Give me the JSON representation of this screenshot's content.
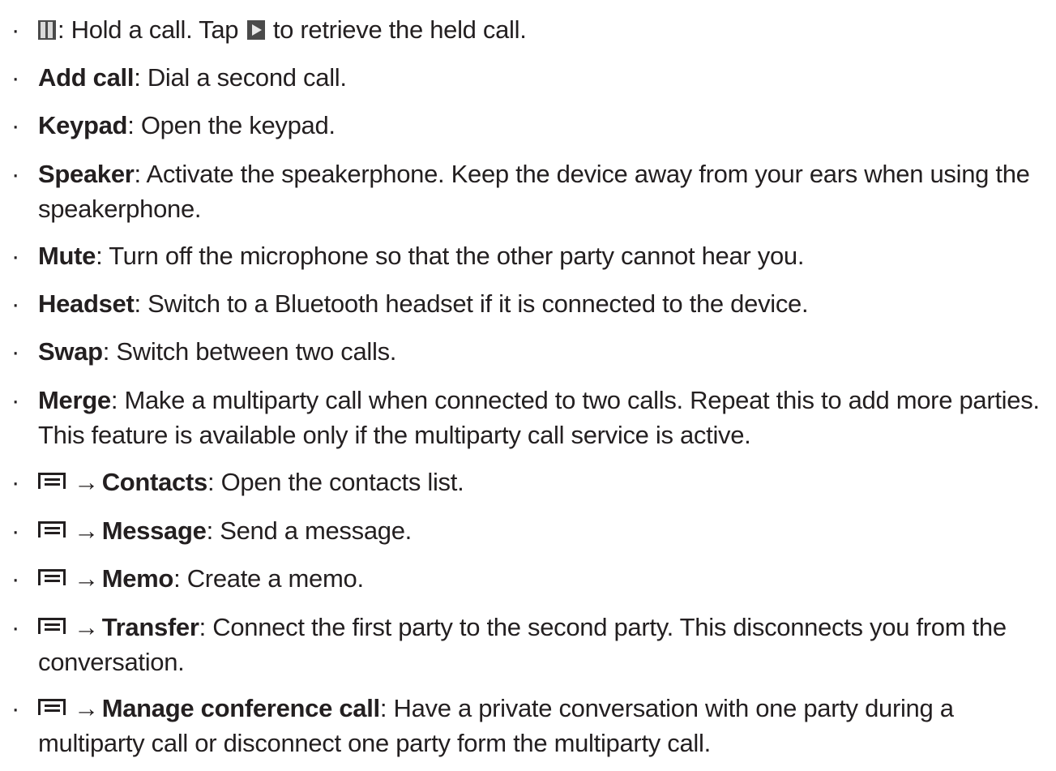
{
  "items": [
    {
      "icon": "pause-icon",
      "label": "",
      "text": ": Hold a call. Tap ",
      "icon2": "play-icon",
      "text2": " to retrieve the held call."
    },
    {
      "label": "Add call",
      "text": ": Dial a second call."
    },
    {
      "label": "Keypad",
      "text": ": Open the keypad."
    },
    {
      "label": "Speaker",
      "text": ": Activate the speakerphone. Keep the device away from your ears when using the speakerphone."
    },
    {
      "label": "Mute",
      "text": ": Turn off the microphone so that the other party cannot hear you."
    },
    {
      "label": "Headset",
      "text": ": Switch to a Bluetooth headset if it is connected to the device."
    },
    {
      "label": "Swap",
      "text": ": Switch between two calls."
    },
    {
      "label": "Merge",
      "text": ": Make a multiparty call when connected to two calls. Repeat this to add more parties. This feature is available only if the multiparty call service is active."
    },
    {
      "icon": "menu-icon",
      "arrow": "→",
      "label": "Contacts",
      "text": ": Open the contacts list."
    },
    {
      "icon": "menu-icon",
      "arrow": "→",
      "label": "Message",
      "text": ": Send a message."
    },
    {
      "icon": "menu-icon",
      "arrow": "→",
      "label": "Memo",
      "text": ": Create a memo."
    },
    {
      "icon": "menu-icon",
      "arrow": "→",
      "label": "Transfer",
      "text": ": Connect the first party to the second party. This disconnects you from the conversation."
    },
    {
      "icon": "menu-icon",
      "arrow": "→",
      "label": "Manage conference call",
      "text": ": Have a private conversation with one party during a multiparty call or disconnect one party form the multiparty call."
    }
  ],
  "bullet": "·"
}
